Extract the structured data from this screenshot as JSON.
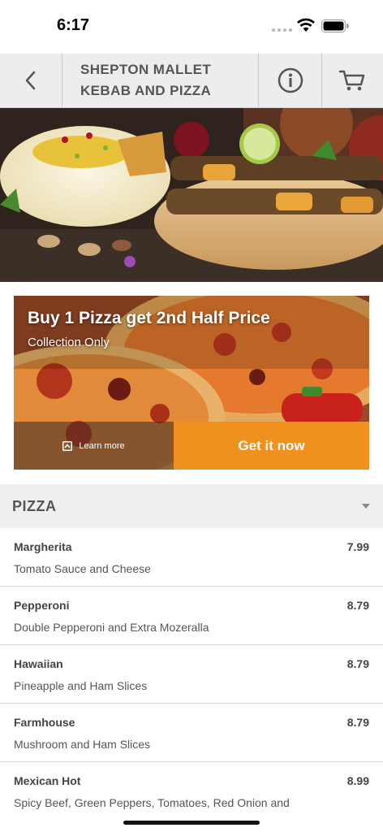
{
  "status_bar": {
    "time": "6:17"
  },
  "header": {
    "title_line1": "SHEPTON MALLET",
    "title_line2": "KEBAB AND PIZZA"
  },
  "promo": {
    "title": "Buy 1 Pizza get 2nd Half Price",
    "subtitle": "Collection Only",
    "learn_more": "Learn more",
    "cta": "Get it now",
    "cta_color": "#f0901f"
  },
  "category": {
    "title": "PIZZA"
  },
  "menu": [
    {
      "name": "Margherita",
      "price": "7.99",
      "desc": "Tomato Sauce and Cheese"
    },
    {
      "name": "Pepperoni",
      "price": "8.79",
      "desc": "Double Pepperoni and Extra Mozeralla"
    },
    {
      "name": "Hawaiian",
      "price": "8.79",
      "desc": "Pineapple and Ham Slices"
    },
    {
      "name": "Farmhouse",
      "price": "8.79",
      "desc": "Mushroom and Ham Slices"
    },
    {
      "name": "Mexican Hot",
      "price": "8.99",
      "desc": "Spicy Beef, Green Peppers, Tomatoes, Red Onion and"
    }
  ],
  "icons": {
    "back": "chevron-left-icon",
    "info": "info-icon",
    "cart": "cart-icon"
  }
}
